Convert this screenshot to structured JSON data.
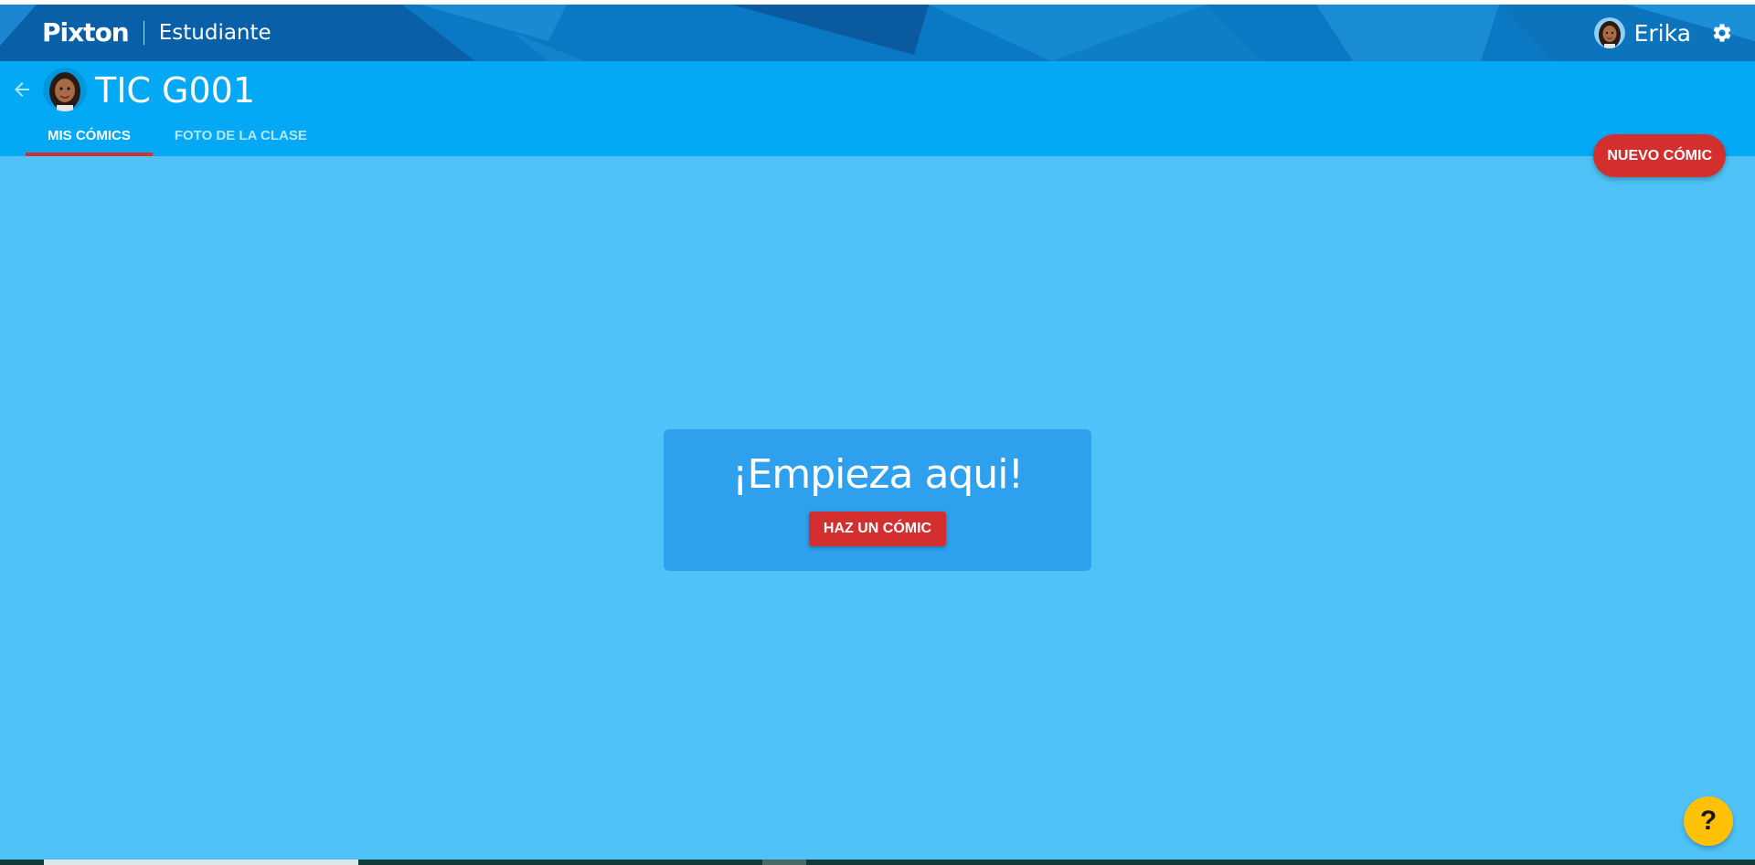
{
  "header": {
    "logo_text": "Pixton",
    "role": "Estudiante",
    "user_name": "Erika",
    "colors": {
      "band": "#0a78c4"
    }
  },
  "class": {
    "title": "TIC G001",
    "tabs": [
      {
        "label": "MIS CÓMICS",
        "active": true
      },
      {
        "label": "FOTO DE LA CLASE",
        "active": false
      }
    ],
    "new_comic_label": "NUEVO CÓMIC",
    "colors": {
      "bar": "#03a9f4"
    }
  },
  "main": {
    "start_title": "¡Empieza aqui!",
    "start_button_label": "HAZ UN CÓMIC",
    "colors": {
      "background": "#4fc3f7",
      "card": "#2ea0ee",
      "accent": "#d32f2f"
    }
  },
  "help": {
    "label": "?",
    "color": "#ffc107"
  },
  "icons": {
    "back": "arrow-left-icon",
    "settings": "gear-icon",
    "help": "question-icon"
  }
}
